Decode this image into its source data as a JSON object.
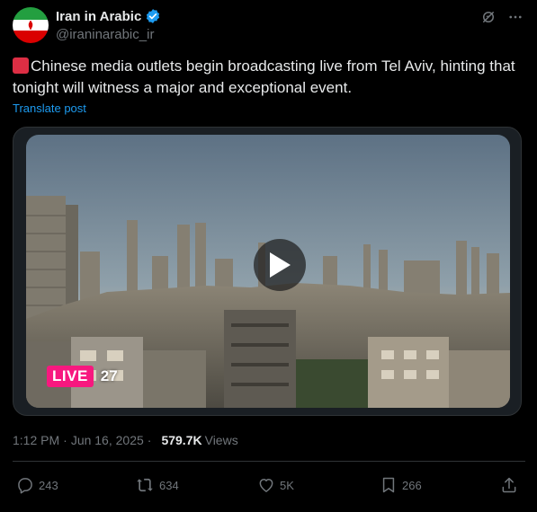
{
  "author": {
    "display_name": "Iran in Arabic",
    "handle": "@iraninarabic_ir",
    "verified": true,
    "avatar_icon": "iran-flag-avatar"
  },
  "post": {
    "text": "Chinese media outlets begin broadcasting live from Tel Aviv, hinting that tonight will witness a major and exceptional event.",
    "leading_emoji": "red-square",
    "translate_label": "Translate post"
  },
  "media": {
    "live_label": "LIVE",
    "live_viewers": "27",
    "play_icon": "play-icon"
  },
  "meta": {
    "time": "1:12 PM",
    "separator": "·",
    "date": "Jun 16, 2025",
    "views_count": "579.7K",
    "views_label": "Views"
  },
  "actions": {
    "replies": "243",
    "reposts": "634",
    "likes": "5K",
    "bookmarks": "266"
  },
  "colors": {
    "background": "#000000",
    "text_primary": "#e7e9ea",
    "text_secondary": "#71767b",
    "link": "#1d9bf0",
    "verified": "#1d9bf0",
    "live_badge": "#f7187f",
    "divider": "#2f3336"
  }
}
